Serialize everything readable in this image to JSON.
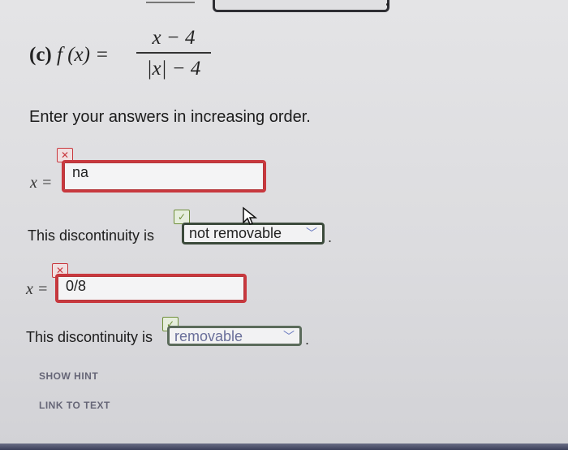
{
  "problem": {
    "part_label": "(c)",
    "function_lhs": "f (x) =",
    "numerator": "x − 4",
    "denominator": "|x| − 4"
  },
  "instructions": "Enter your answers in increasing order.",
  "answers": [
    {
      "var_label": "x =",
      "value": "na",
      "status": "incorrect",
      "badge_glyph": "✕",
      "discontinuity_prefix": "This discontinuity is",
      "discontinuity_value": "not removable",
      "discontinuity_status": "correct",
      "discontinuity_badge_glyph": "✓"
    },
    {
      "var_label": "x =",
      "value": "0/8",
      "status": "incorrect",
      "badge_glyph": "✕",
      "discontinuity_prefix": "This discontinuity is",
      "discontinuity_value": "removable",
      "discontinuity_status": "correct",
      "discontinuity_badge_glyph": "✓"
    }
  ],
  "period": ".",
  "links": {
    "show_hint": "SHOW HINT",
    "link_to_text": "LINK TO TEXT"
  },
  "icons": {
    "dropdown": "chevron-down-icon",
    "cursor": "mouse-pointer-icon"
  },
  "colors": {
    "incorrect": "#c8383e",
    "correct": "#6f8f3a",
    "select_border": "#3b4a3b",
    "link": "#667788"
  }
}
